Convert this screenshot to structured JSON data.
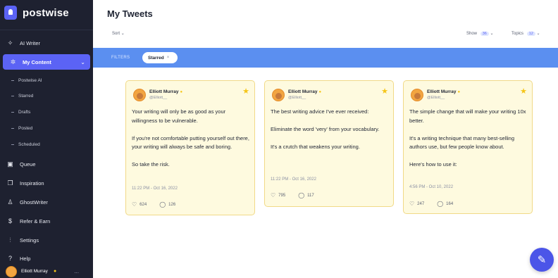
{
  "app": {
    "name": "postwise"
  },
  "sidebar": {
    "items": [
      {
        "label": "AI Writer",
        "icon": "sparkle-icon"
      },
      {
        "label": "My Content",
        "icon": "grid-icon"
      },
      {
        "label": "Queue",
        "icon": "calendar-icon"
      },
      {
        "label": "Inspiration",
        "icon": "book-icon"
      },
      {
        "label": "GhostWriter",
        "icon": "ghost-icon"
      },
      {
        "label": "Refer & Earn",
        "icon": "dollar-icon"
      },
      {
        "label": "Settings",
        "icon": "sliders-icon"
      },
      {
        "label": "Help",
        "icon": "help-icon"
      }
    ],
    "sub_items": [
      {
        "label": "Postwise AI"
      },
      {
        "label": "Starred"
      },
      {
        "label": "Drafts"
      },
      {
        "label": "Posted"
      },
      {
        "label": "Scheduled"
      }
    ],
    "profile": {
      "name": "Elliott Murray",
      "more": "..."
    }
  },
  "header": {
    "title": "My Tweets"
  },
  "toolbar": {
    "sort_label": "Sort",
    "show_label": "Show",
    "show_value": "36",
    "topics_label": "Topics",
    "topics_value": "12"
  },
  "filter": {
    "label": "FILTERS",
    "chip": "Starred",
    "chip_close": "×"
  },
  "cards": [
    {
      "name": "Elliott Murray",
      "handle": "@Elliott__",
      "paragraphs": [
        "Your writing will only be as good as your willingness to be vulnerable.",
        "If you're not comfortable putting yourself out there, your writing will always be safe and boring.",
        "So take the risk."
      ],
      "time": "11:22 PM - Oct 16, 2022",
      "likes": "624",
      "replies": "126"
    },
    {
      "name": "Elliott Murray",
      "handle": "@Elliott__",
      "paragraphs": [
        "The best writing advice I've ever received:",
        "Eliminate the word 'very' from your vocabulary.",
        "It's a crutch that weakens your writing."
      ],
      "time": "11:22 PM - Oct 16, 2022",
      "likes": "795",
      "replies": "117"
    },
    {
      "name": "Elliott Murray",
      "handle": "@Elliott__",
      "paragraphs": [
        "The simple change that will make your writing 10x better.",
        "It's a writing technique that many best-selling authors use, but few people know about.",
        "Here's how to use it:"
      ],
      "time": "4:56 PM - Oct 10, 2022",
      "likes": "247",
      "replies": "164"
    }
  ],
  "colors": {
    "sidebar_bg": "#1e2130",
    "accent": "#5b63f5",
    "filter_bar": "#5b8ff0",
    "card_bg": "#fefadf",
    "star": "#f5c518"
  }
}
